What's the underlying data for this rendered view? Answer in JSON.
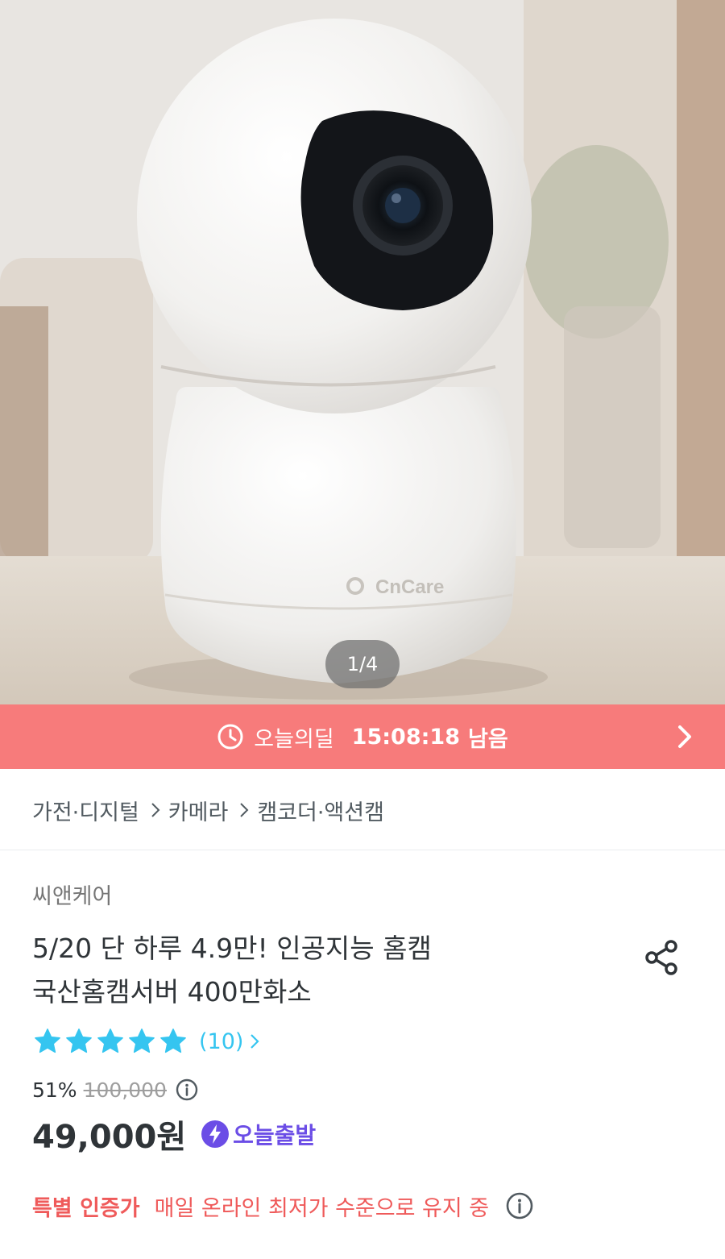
{
  "product_image": {
    "brand_mark": "CnCare",
    "counter": "1/4"
  },
  "deal_banner": {
    "label": "오늘의딜",
    "timer": "15:08:18",
    "remaining": "남음",
    "clock_icon": "clock-icon",
    "arrow_icon": "chevron-right-icon"
  },
  "breadcrumb": {
    "items": [
      "가전·디지털",
      "카메라",
      "캠코더·액션캠"
    ]
  },
  "product": {
    "brand": "씨앤케어",
    "title_line1": "5/20 단 하루 4.9만! 인공지능 홈캠",
    "title_line2": "국산홈캠서버 400만화소",
    "rating_stars": 5,
    "review_count": "(10)",
    "discount": "51%",
    "original_price": "100,000",
    "price": "49,000원",
    "shipping_badge": "오늘출발"
  },
  "certification": {
    "label": "특별 인증가",
    "description": "매일 온라인 최저가 수준으로 유지 중"
  },
  "colors": {
    "deal_banner": "#f77b7b",
    "star": "#35c5f0",
    "shipping_badge": "#6b4de6",
    "certification": "#ef5a5a"
  }
}
